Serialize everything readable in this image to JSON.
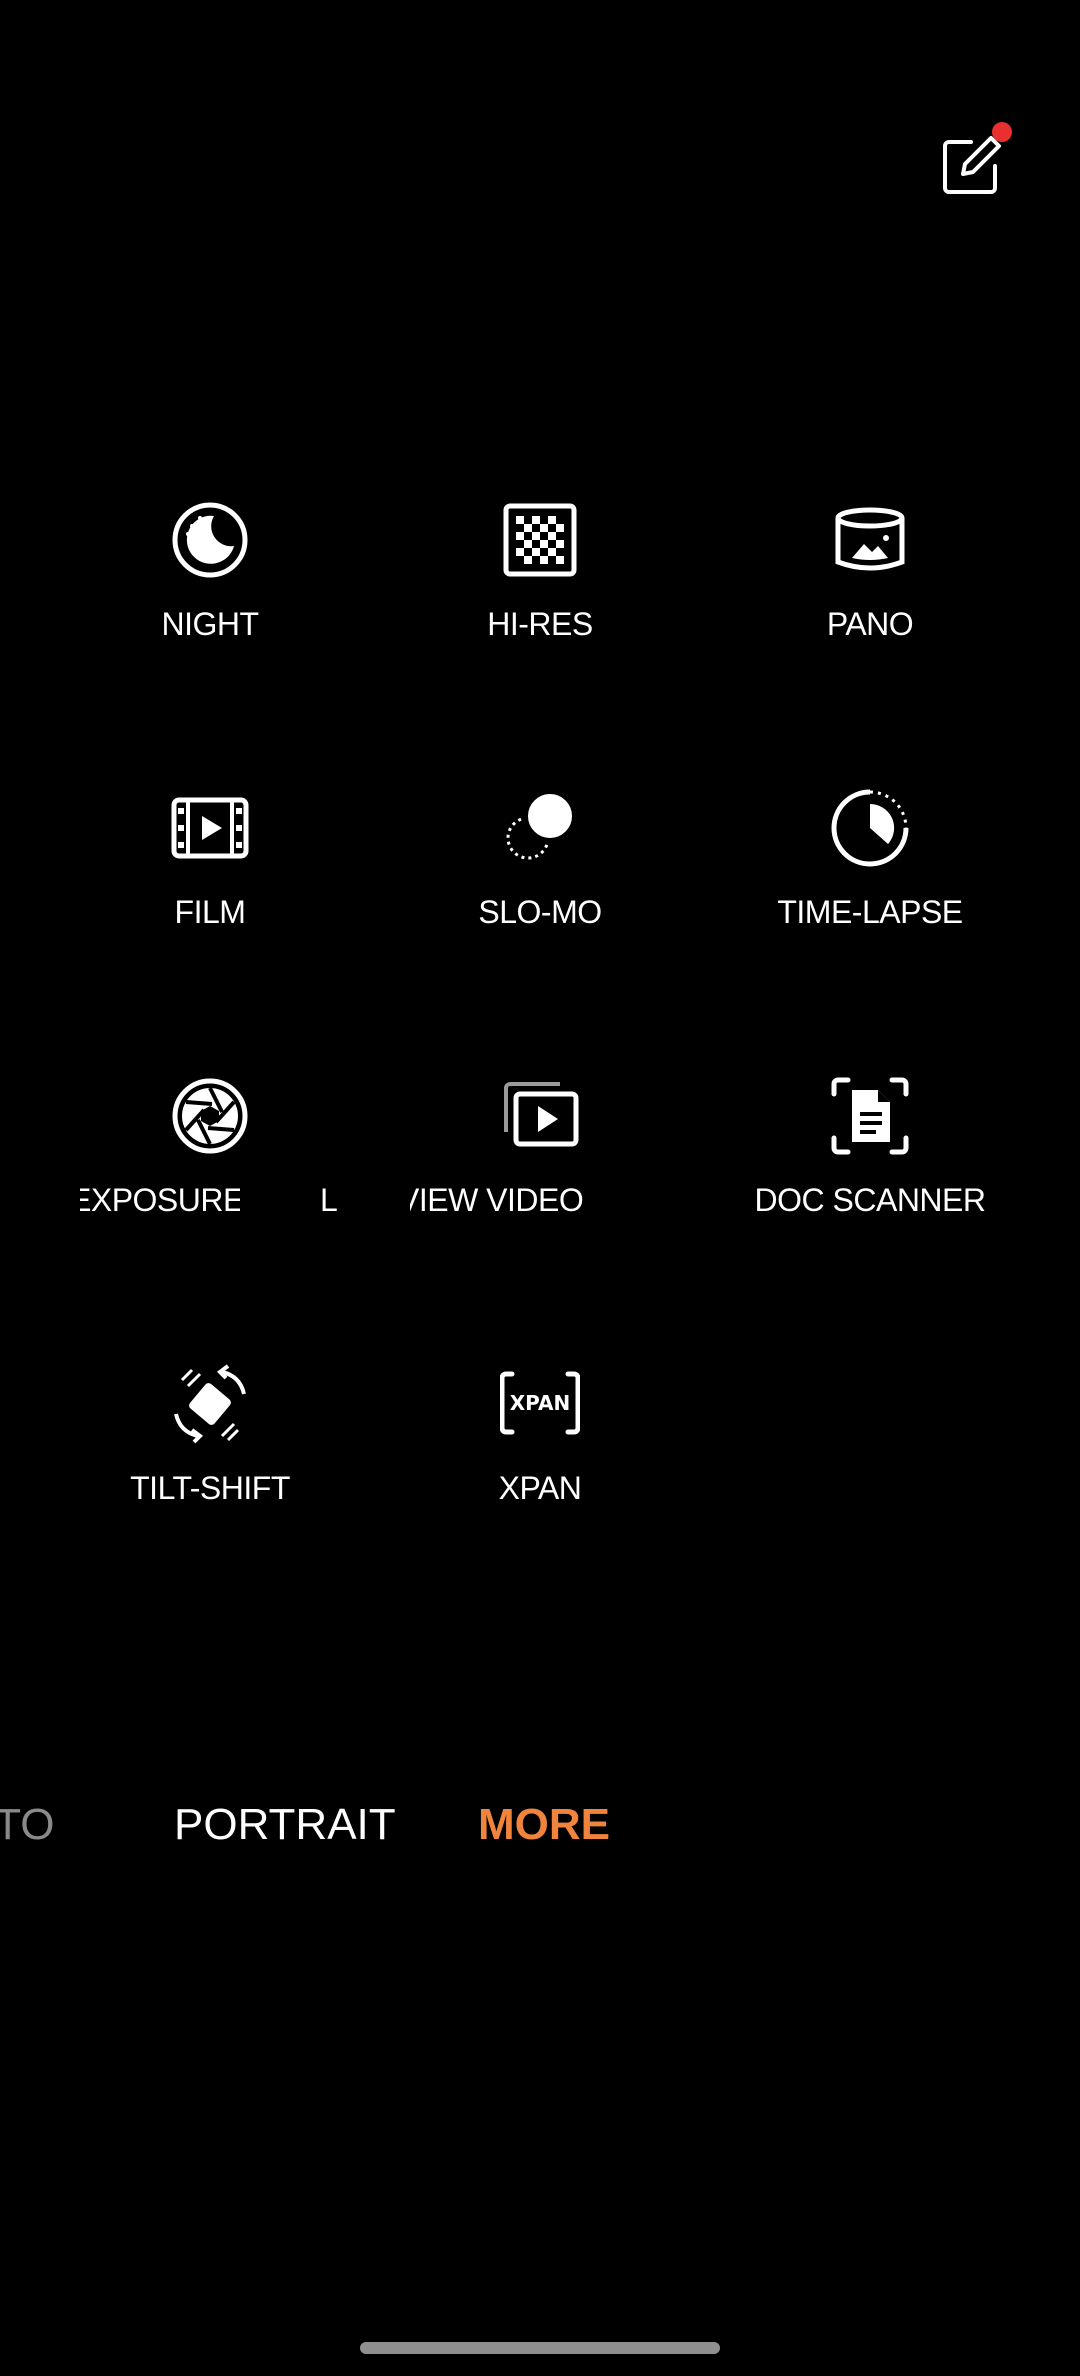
{
  "header": {
    "edit_icon": "edit-pencil-icon",
    "badge_color": "#e8302f"
  },
  "modes": [
    {
      "label": "NIGHT",
      "icon": "night-moon-icon"
    },
    {
      "label": "HI-RES",
      "icon": "hi-res-checker-icon"
    },
    {
      "label": "PANO",
      "icon": "panorama-icon"
    },
    {
      "label": "FILM",
      "icon": "film-icon"
    },
    {
      "label": "SLO-MO",
      "icon": "slow-motion-icon"
    },
    {
      "label": "TIME-LAPSE",
      "icon": "time-lapse-icon"
    },
    {
      "label": "EXPOSURE",
      "icon": "aperture-icon"
    },
    {
      "label": "L",
      "icon": ""
    },
    {
      "label": "VIEW VIDEO",
      "icon": "view-video-icon"
    },
    {
      "label": "DOC SCANNER",
      "icon": "document-scanner-icon"
    },
    {
      "label": "TILT-SHIFT",
      "icon": "tilt-shift-icon"
    },
    {
      "label": "XPAN",
      "icon": "xpan-icon",
      "icon_text": "XPAN"
    }
  ],
  "bottom_modes": {
    "photo": "OTO",
    "portrait": "PORTRAIT",
    "more": "MORE",
    "active_color": "#f0843c"
  }
}
